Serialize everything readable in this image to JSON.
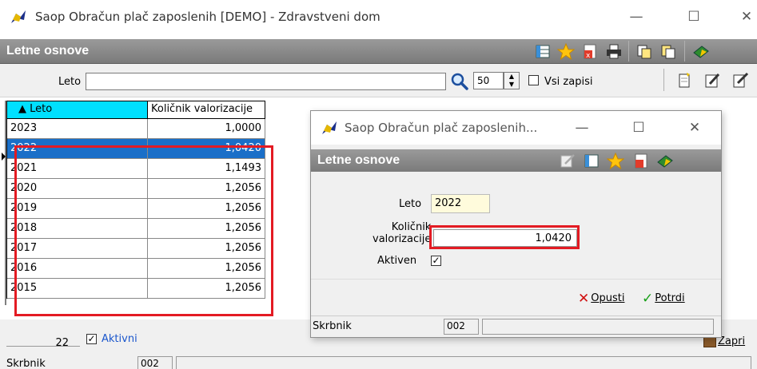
{
  "window": {
    "title": "Saop Obračun plač zaposlenih [DEMO] - Zdravstveni dom",
    "minimize": "—",
    "maximize": "☐",
    "close": "✕"
  },
  "header": {
    "title": "Letne osnove"
  },
  "filter": {
    "leto_label": "Leto",
    "leto_value": "",
    "page_size": "50",
    "all_records_label": "Vsi zapisi"
  },
  "grid": {
    "columns": [
      "▲ Leto",
      "Količnik valorizacije"
    ],
    "rows": [
      {
        "leto": "2023",
        "kolicnik": "1,0000"
      },
      {
        "leto": "2022",
        "kolicnik": "1,0420"
      },
      {
        "leto": "2021",
        "kolicnik": "1,1493"
      },
      {
        "leto": "2020",
        "kolicnik": "1,2056"
      },
      {
        "leto": "2019",
        "kolicnik": "1,2056"
      },
      {
        "leto": "2018",
        "kolicnik": "1,2056"
      },
      {
        "leto": "2017",
        "kolicnik": "1,2056"
      },
      {
        "leto": "2016",
        "kolicnik": "1,2056"
      },
      {
        "leto": "2015",
        "kolicnik": "1,2056"
      }
    ],
    "selected_index": 1
  },
  "footer": {
    "count": "22",
    "active_label": "Aktivni",
    "skrbnik_label": "Skrbnik",
    "skrbnik_value": "002",
    "close_label": "Zapri"
  },
  "dialog": {
    "title": "Saop Obračun plač zaposlenih...",
    "header": "Letne osnove",
    "leto_label": "Leto",
    "leto_value": "2022",
    "kolicnik_label_1": "Količnik",
    "kolicnik_label_2": "valorizacije",
    "kolicnik_value": "1,0420",
    "aktiven_label": "Aktiven",
    "cancel_label": "Opusti",
    "confirm_label": "Potrdi",
    "skrbnik_label": "Skrbnik",
    "skrbnik_value": "002"
  },
  "colors": {
    "header_band": "#7a7a7a",
    "selection": "#1a6fc8",
    "sort_header": "#00e0ff",
    "highlight_box": "#e31b23",
    "yellow_field": "#fffbdc"
  }
}
